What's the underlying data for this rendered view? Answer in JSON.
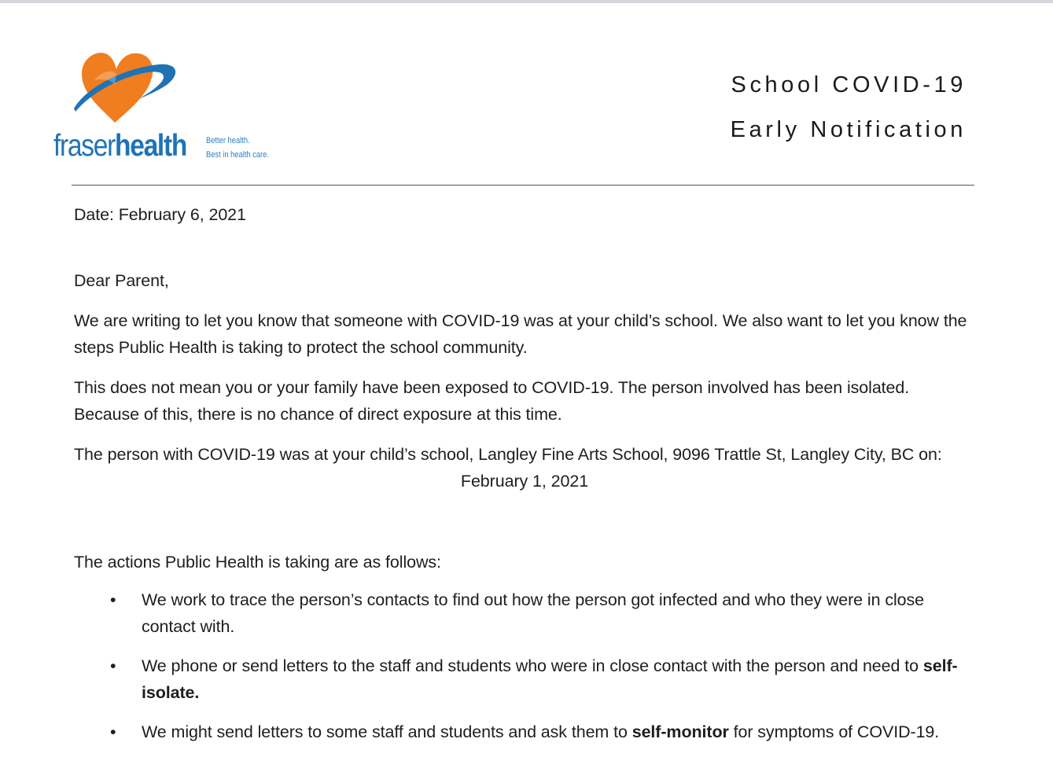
{
  "header": {
    "logo": {
      "word_part1": "fraser",
      "word_part2": "health",
      "tagline_line1": "Better health.",
      "tagline_line2": "Best in health care.",
      "colors": {
        "orange": "#f07d1f",
        "blue": "#1f73b5"
      }
    },
    "title_line1": "School COVID-19",
    "title_line2": "Early Notification"
  },
  "letter": {
    "date_line": "Date: February 6, 2021",
    "salutation": "Dear Parent,",
    "para1": "We are writing to let you know that someone with COVID-19 was at your child’s school. We also want to let you know the steps Public Health is taking to protect the school community.",
    "para2": "This does not mean you or your family have been exposed to COVID-19. The person involved has been isolated. Because of this, there is no chance of direct exposure at this time.",
    "para3": "The person with COVID-19 was at your child’s school, Langley Fine Arts School, 9096 Trattle St, Langley City, BC  on:",
    "incident_date": "February 1, 2021",
    "actions_intro": "The actions Public Health is taking are as follows:",
    "bullet_symbol": "•",
    "actions": [
      {
        "before": "We work to trace the person’s contacts to find out how the person got infected and who they were in close contact with.",
        "bold": "",
        "after": ""
      },
      {
        "before": "We phone or send letters to the staff and students who were in close contact with the person and need to ",
        "bold": "self-isolate.",
        "after": ""
      },
      {
        "before": "We might send letters to some staff and students and ask them to ",
        "bold": "self-monitor",
        "after": " for symptoms of COVID-19."
      }
    ]
  }
}
